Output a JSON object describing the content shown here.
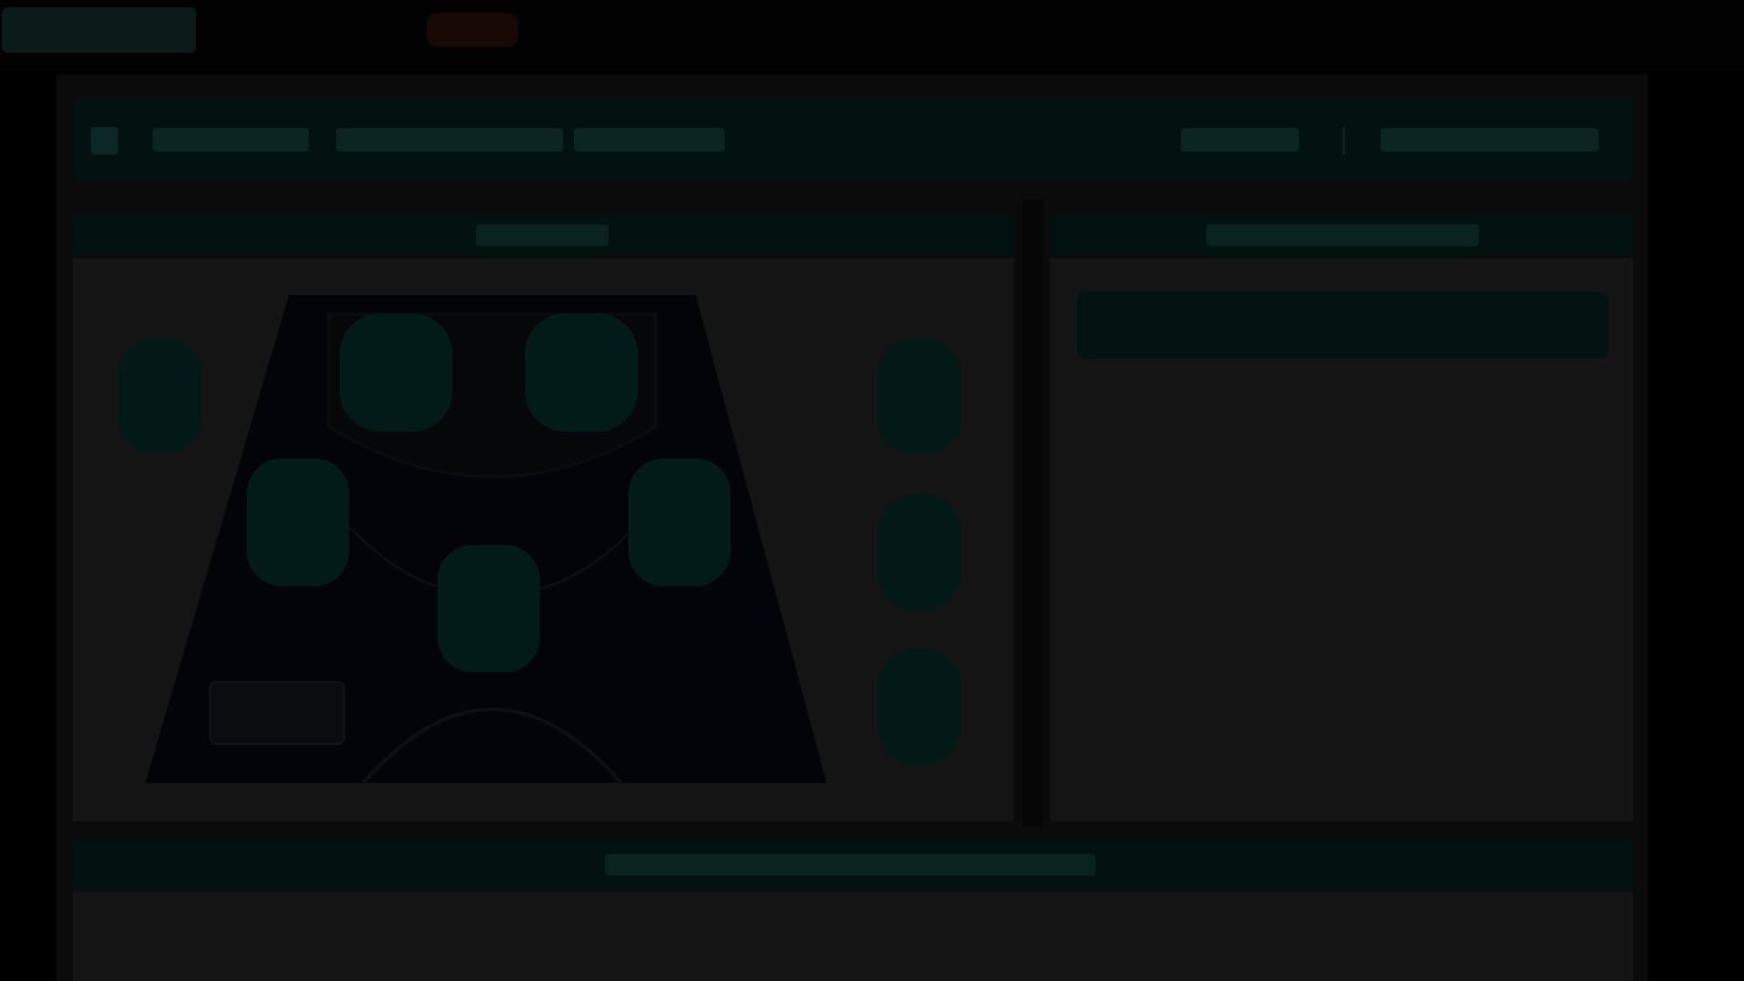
{
  "top_bar": {
    "logo_label": "",
    "alert_label": ""
  },
  "game_header": {
    "title": "",
    "subtitle": "",
    "stat_a": "",
    "stat_b": ""
  },
  "court_panel": {
    "title": ""
  },
  "side_panel": {
    "title": "",
    "banner_text": ""
  },
  "bottom_panel": {
    "title": ""
  },
  "colors": {
    "accent": "#0c2523",
    "header_bg": "#021211",
    "panel_bg": "#141414",
    "court_bg": "#030409",
    "player_token": "#021a18",
    "alert": "#190906"
  }
}
